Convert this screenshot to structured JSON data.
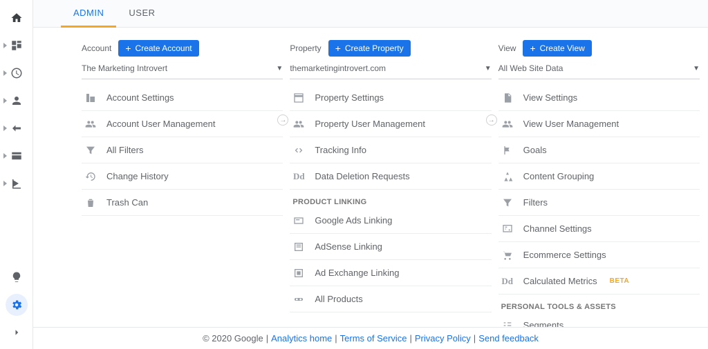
{
  "tabs": {
    "admin": "ADMIN",
    "user": "USER"
  },
  "account": {
    "label": "Account",
    "create": "Create Account",
    "selected": "The Marketing Introvert",
    "items": {
      "settings": "Account Settings",
      "users": "Account User Management",
      "filters": "All Filters",
      "history": "Change History",
      "trash": "Trash Can"
    }
  },
  "property": {
    "label": "Property",
    "create": "Create Property",
    "selected": "themarketingintrovert.com",
    "items": {
      "settings": "Property Settings",
      "users": "Property User Management",
      "tracking": "Tracking Info",
      "deletion": "Data Deletion Requests"
    },
    "section1": "PRODUCT LINKING",
    "linking": {
      "ads": "Google Ads Linking",
      "adsense": "AdSense Linking",
      "adexchange": "Ad Exchange Linking",
      "all": "All Products"
    }
  },
  "view": {
    "label": "View",
    "create": "Create View",
    "selected": "All Web Site Data",
    "items": {
      "settings": "View Settings",
      "users": "View User Management",
      "goals": "Goals",
      "grouping": "Content Grouping",
      "filters": "Filters",
      "channel": "Channel Settings",
      "ecommerce": "Ecommerce Settings",
      "calculated": "Calculated Metrics",
      "beta": "BETA"
    },
    "section1": "PERSONAL TOOLS & ASSETS",
    "tools": {
      "segments": "Segments"
    }
  },
  "footer": {
    "copyright": "© 2020 Google",
    "home": "Analytics home",
    "terms": "Terms of Service",
    "privacy": "Privacy Policy",
    "feedback": "Send feedback"
  }
}
